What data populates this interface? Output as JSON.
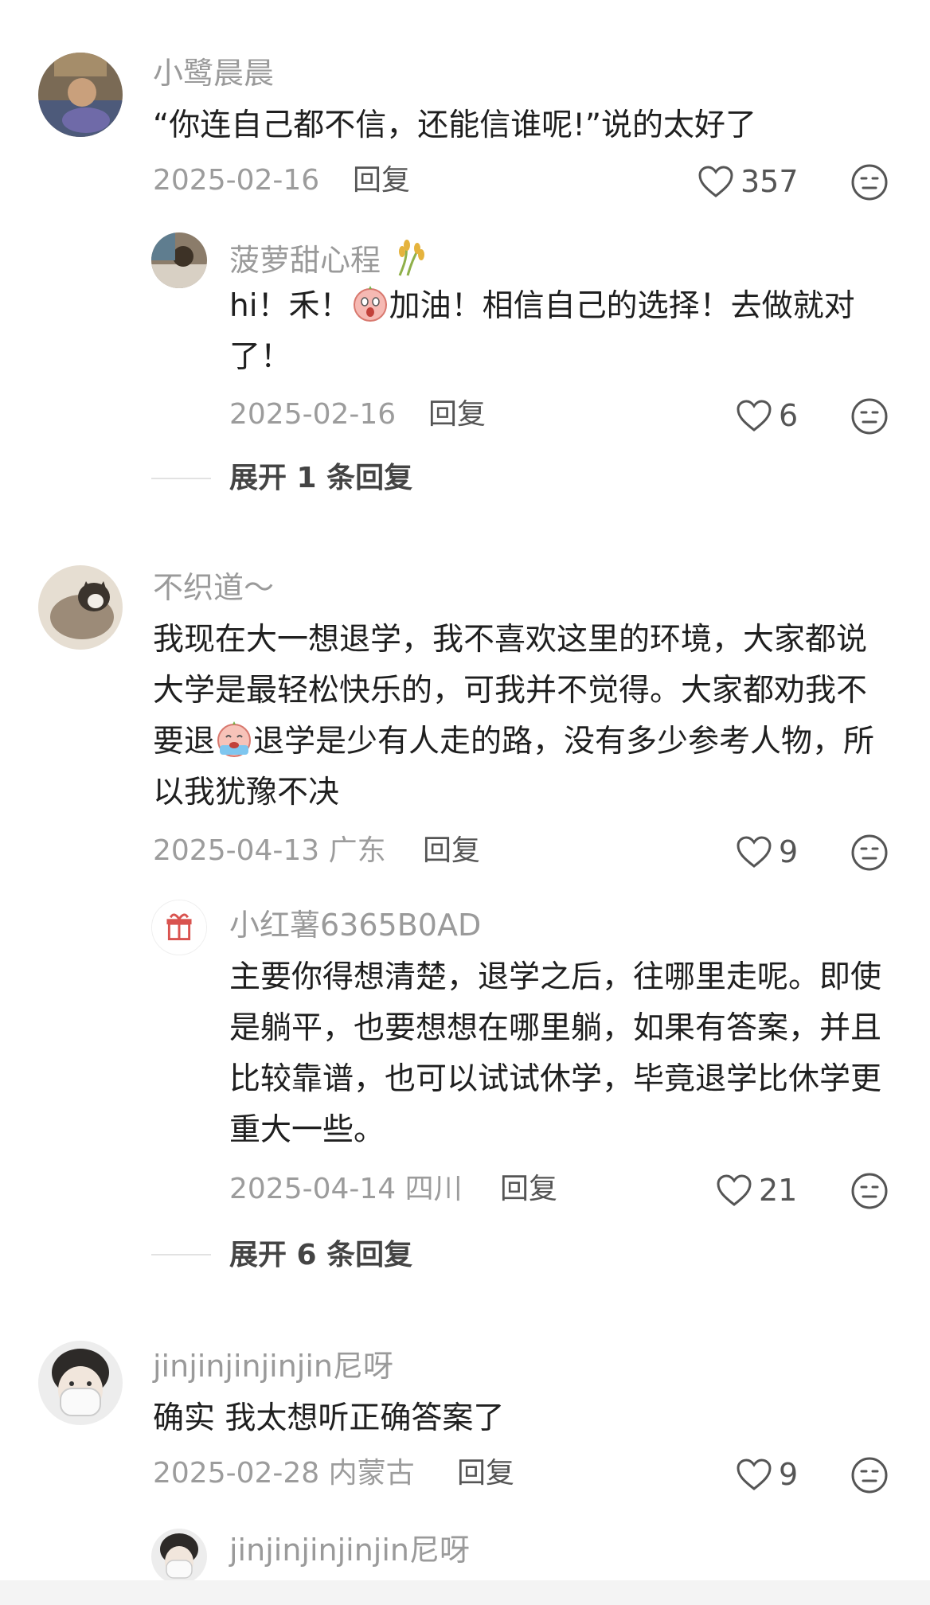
{
  "comments": [
    {
      "user": "小鹭晨晨",
      "text": "“你连自己都不信，还能信谁呢!”说的太好了",
      "date": "2025-02-16",
      "reply_label": "回复",
      "likes": "357",
      "replies": [
        {
          "user": "菠萝甜心程",
          "user_badge": "rice-icon",
          "text_before": "hi！禾！",
          "emoji": "surprised-face-emoji",
          "text_after": "加油！相信自己的选择！去做就对了！",
          "date": "2025-02-16",
          "reply_label": "回复",
          "likes": "6"
        }
      ],
      "expand_label": "展开 1 条回复"
    },
    {
      "user": "不织道～",
      "text_before": "我现在大一想退学，我不喜欢这里的环境，大家都说大学是最轻松快乐的，可我并不觉得。大家都劝我不要退",
      "emoji": "crying-face-emoji",
      "text_after": "退学是少有人走的路，没有多少参考人物，所以我犹豫不决",
      "date": "2025-04-13 广东",
      "reply_label": "回复",
      "likes": "9",
      "replies": [
        {
          "user": "小红薯6365B0AD",
          "text": "主要你得想清楚，退学之后，往哪里走呢。即使是躺平，也要想想在哪里躺，如果有答案，并且比较靠谱，也可以试试休学，毕竟退学比休学更重大一些。",
          "date": "2025-04-14 四川",
          "reply_label": "回复",
          "likes": "21"
        }
      ],
      "expand_label": "展开 6 条回复"
    },
    {
      "user": "jinjinjinjinjin尼呀",
      "text": "确实 我太想听正确答案了",
      "date": "2025-02-28 内蒙古",
      "reply_label": "回复",
      "likes": "9",
      "replies": [
        {
          "user": "jinjinjinjinjin尼呀"
        }
      ]
    }
  ],
  "colors": {
    "muted": "#9a9a9a",
    "text": "#1f1f1f",
    "action": "#555555"
  }
}
